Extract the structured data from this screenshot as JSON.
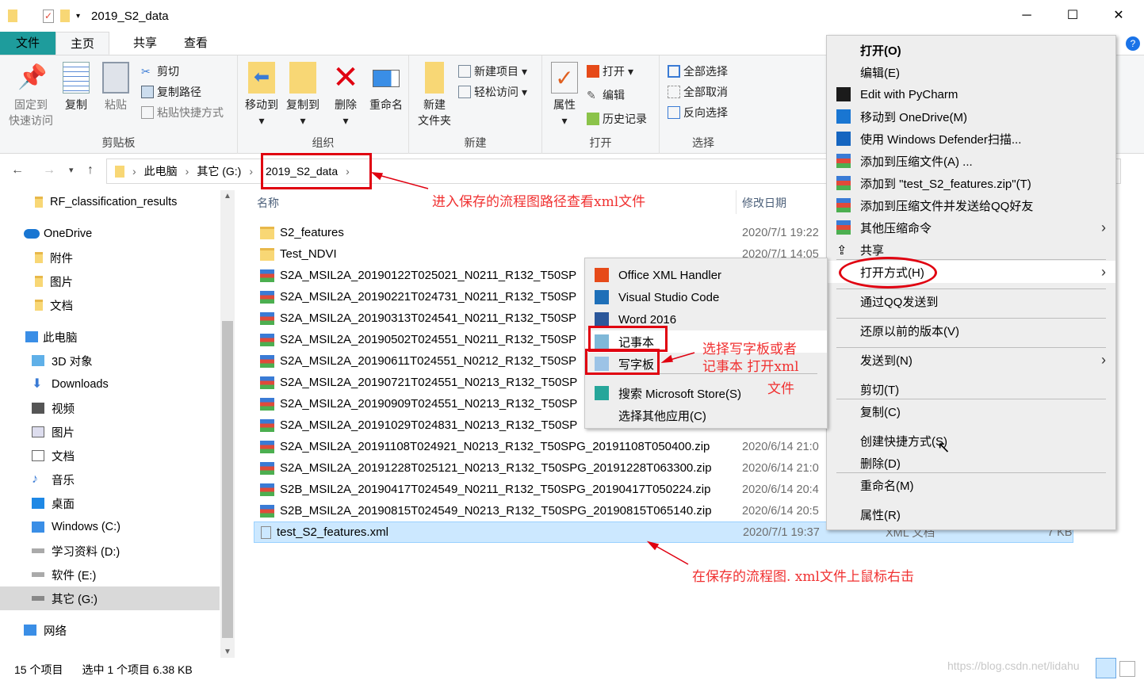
{
  "window": {
    "title": "2019_S2_data",
    "minimize": "─",
    "maximize": "☐",
    "close": "✕"
  },
  "tabs": [
    {
      "label": "文件"
    },
    {
      "label": "主页"
    },
    {
      "label": "共享"
    },
    {
      "label": "查看"
    }
  ],
  "ribbon": {
    "clipboard": {
      "label": "剪贴板",
      "pin": "固定到",
      "pin2": "快速访问",
      "copy": "复制",
      "paste": "粘贴",
      "cut": "剪切",
      "copy_path": "复制路径",
      "paste_shortcut": "粘贴快捷方式"
    },
    "organize": {
      "label": "组织",
      "move_to": "移动到",
      "copy_to": "复制到",
      "delete": "删除",
      "rename": "重命名"
    },
    "new": {
      "label": "新建",
      "new_folder": "新建",
      "new_folder2": "文件夹",
      "new_item": "新建项目",
      "easy_access": "轻松访问"
    },
    "open": {
      "label": "打开",
      "properties": "属性",
      "open": "打开",
      "edit": "编辑",
      "history": "历史记录"
    },
    "select": {
      "label": "选择",
      "select_all": "全部选择",
      "select_none": "全部取消",
      "invert": "反向选择"
    }
  },
  "address": {
    "crumbs": [
      "此电脑",
      "其它 (G:)",
      "2019_S2_data"
    ]
  },
  "nav": [
    {
      "label": "RF_classification_results"
    },
    {
      "label": "OneDrive"
    },
    {
      "label": "附件"
    },
    {
      "label": "图片"
    },
    {
      "label": "文档"
    },
    {
      "label": "此电脑"
    },
    {
      "label": "3D 对象"
    },
    {
      "label": "Downloads"
    },
    {
      "label": "视频"
    },
    {
      "label": "图片"
    },
    {
      "label": "文档"
    },
    {
      "label": "音乐"
    },
    {
      "label": "桌面"
    },
    {
      "label": "Windows (C:)"
    },
    {
      "label": "学习资料 (D:)"
    },
    {
      "label": "软件 (E:)"
    },
    {
      "label": "其它 (G:)"
    },
    {
      "label": "网络"
    }
  ],
  "list": {
    "headers": {
      "name": "名称",
      "date": "修改日期"
    },
    "files": [
      {
        "name": "S2_features",
        "date": "2020/7/1 19:22",
        "type": "folder"
      },
      {
        "name": "Test_NDVI",
        "date": "2020/7/1 14:05",
        "type": "folder"
      },
      {
        "name": "S2A_MSIL2A_20190122T025021_N0211_R132_T50SP",
        "date": "",
        "type": "zip"
      },
      {
        "name": "S2A_MSIL2A_20190221T024731_N0211_R132_T50SP",
        "date": "",
        "type": "zip"
      },
      {
        "name": "S2A_MSIL2A_20190313T024541_N0211_R132_T50SP",
        "date": "",
        "type": "zip"
      },
      {
        "name": "S2A_MSIL2A_20190502T024551_N0211_R132_T50SP",
        "date": "",
        "type": "zip"
      },
      {
        "name": "S2A_MSIL2A_20190611T024551_N0212_R132_T50SP",
        "date": "",
        "type": "zip"
      },
      {
        "name": "S2A_MSIL2A_20190721T024551_N0213_R132_T50SP",
        "date": "",
        "type": "zip"
      },
      {
        "name": "S2A_MSIL2A_20190909T024551_N0213_R132_T50SP",
        "date": "",
        "type": "zip"
      },
      {
        "name": "S2A_MSIL2A_20191029T024831_N0213_R132_T50SP",
        "date": "",
        "type": "zip"
      },
      {
        "name": "S2A_MSIL2A_20191108T024921_N0213_R132_T50SPG_20191108T050400.zip",
        "date": "2020/6/14 21:0",
        "type": "zip"
      },
      {
        "name": "S2A_MSIL2A_20191228T025121_N0213_R132_T50SPG_20191228T063300.zip",
        "date": "2020/6/14 21:0",
        "type": "zip"
      },
      {
        "name": "S2B_MSIL2A_20190417T024549_N0211_R132_T50SPG_20190417T050224.zip",
        "date": "2020/6/14 20:4",
        "type": "zip"
      },
      {
        "name": "S2B_MSIL2A_20190815T024549_N0213_R132_T50SPG_20190815T065140.zip",
        "date": "2020/6/14 20:5",
        "type": "zip"
      },
      {
        "name": "test_S2_features.xml",
        "date": "2020/7/1 19:37",
        "type": "xml",
        "kind": "XML 文档",
        "size": "7 KB"
      }
    ]
  },
  "context_menu": {
    "items": [
      {
        "label": "打开(O)"
      },
      {
        "label": "编辑(E)"
      },
      {
        "label": "Edit with PyCharm"
      },
      {
        "label": "移动到 OneDrive(M)"
      },
      {
        "label": "使用 Windows Defender扫描..."
      },
      {
        "label": "添加到压缩文件(A) ..."
      },
      {
        "label": "添加到 \"test_S2_features.zip\"(T)"
      },
      {
        "label": "添加到压缩文件并发送给QQ好友"
      },
      {
        "label": "其他压缩命令"
      },
      {
        "label": "共享"
      },
      {
        "label": "打开方式(H)"
      },
      {
        "label": "通过QQ发送到"
      },
      {
        "label": "还原以前的版本(V)"
      },
      {
        "label": "发送到(N)"
      },
      {
        "label": "剪切(T)"
      },
      {
        "label": "复制(C)"
      },
      {
        "label": "创建快捷方式(S)"
      },
      {
        "label": "删除(D)"
      },
      {
        "label": "重命名(M)"
      },
      {
        "label": "属性(R)"
      }
    ]
  },
  "open_with_menu": {
    "items": [
      {
        "label": "Office XML Handler"
      },
      {
        "label": "Visual Studio Code"
      },
      {
        "label": "Word 2016"
      },
      {
        "label": "记事本"
      },
      {
        "label": "写字板"
      },
      {
        "label": "搜索 Microsoft Store(S)"
      },
      {
        "label": "选择其他应用(C)"
      }
    ]
  },
  "annotations": {
    "path": "进入保存的流程图路径查看xml文件",
    "choose1": "选择写字板或者",
    "choose2": "记事本 打开xml",
    "choose3": "文件",
    "rightclick": "在保存的流程图. xml文件上鼠标右击"
  },
  "status": {
    "count": "15 个项目",
    "selected": "选中 1 个项目  6.38 KB"
  },
  "watermark": "https://blog.csdn.net/lidahu",
  "colors": {
    "accent": "#1e9c9c",
    "annotation": "#e00010",
    "selection": "#cce8ff"
  }
}
